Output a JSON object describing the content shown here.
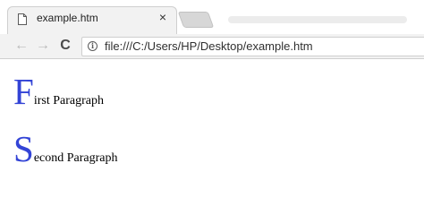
{
  "browser": {
    "tab": {
      "title": "example.htm",
      "close_glyph": "×",
      "icon": "page-icon"
    },
    "toolbar": {
      "back_glyph": "←",
      "forward_glyph": "→",
      "reload_glyph": "C",
      "info_glyph": "i",
      "url": "file:///C:/Users/HP/Desktop/example.htm"
    }
  },
  "page": {
    "paragraphs": [
      {
        "dropcap": "F",
        "rest": "irst Paragraph"
      },
      {
        "dropcap": "S",
        "rest": "econd Paragraph"
      }
    ],
    "dropcap_color": "#3344d6"
  }
}
